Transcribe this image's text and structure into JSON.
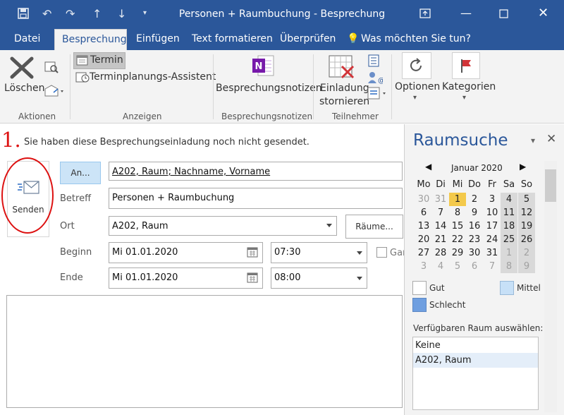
{
  "window": {
    "title": "Personen + Raumbuchung - Besprechung",
    "icons": [
      "save-icon",
      "undo-icon",
      "redo-icon",
      "up-arrow-icon",
      "down-arrow-icon",
      "qat-dropdown-icon",
      "ribbon-display-icon",
      "minimize-icon",
      "maximize-icon",
      "close-icon"
    ]
  },
  "tabs": [
    {
      "label": "Datei"
    },
    {
      "label": "Besprechung"
    },
    {
      "label": "Einfügen"
    },
    {
      "label": "Text formatieren"
    },
    {
      "label": "Überprüfen"
    }
  ],
  "tellme": "Was möchten Sie tun?",
  "ribbon": {
    "loeschen": "Löschen",
    "termin": "Termin",
    "assistent": "Terminplanungs-Assistent",
    "notizen": "Besprechungsnotizen",
    "einladung_1": "Einladung",
    "einladung_2": "stornieren",
    "optionen": "Optionen",
    "kategorien": "Kategorien",
    "groups": {
      "aktionen": "Aktionen",
      "anzeigen": "Anzeigen",
      "notizen": "Besprechungsnotizen",
      "teilnehmer": "Teilnehmer"
    }
  },
  "form": {
    "step": "1.",
    "notice": "Sie haben diese Besprechungseinladung noch nicht gesendet.",
    "send": "Senden",
    "an_btn": "An...",
    "to_value": "A202, Raum; Nachname, Vorname",
    "betreff_label": "Betreff",
    "betreff_value": "Personen + Raumbuchung",
    "ort_label": "Ort",
    "ort_value": "A202, Raum",
    "raeume_btn": "Räume...",
    "beginn_label": "Beginn",
    "beginn_date": "Mi 01.01.2020",
    "beginn_time": "07:30",
    "ende_label": "Ende",
    "ende_date": "Mi 01.01.2020",
    "ende_time": "08:00",
    "ganz_label": "Gar"
  },
  "pane": {
    "title": "Raumsuche",
    "month": "Januar 2020",
    "dow": [
      "Mo",
      "Di",
      "Mi",
      "Do",
      "Fr",
      "Sa",
      "So"
    ],
    "weeks": [
      [
        30,
        31,
        1,
        2,
        3,
        4,
        5
      ],
      [
        6,
        7,
        8,
        9,
        10,
        11,
        12
      ],
      [
        13,
        14,
        15,
        16,
        17,
        18,
        19
      ],
      [
        20,
        21,
        22,
        23,
        24,
        25,
        26
      ],
      [
        27,
        28,
        29,
        30,
        31,
        1,
        2
      ],
      [
        3,
        4,
        5,
        6,
        7,
        8,
        9
      ]
    ],
    "legend_gut": "Gut",
    "legend_mittel": "Mittel",
    "legend_schlecht": "Schlecht",
    "room_label": "Verfügbaren Raum auswählen:",
    "rooms": [
      "Keine",
      "A202, Raum"
    ],
    "selected_room": "A202, Raum"
  },
  "colors": {
    "accent": "#2b579a",
    "today": "#f3c94b",
    "highlight_red": "#dd1111"
  }
}
